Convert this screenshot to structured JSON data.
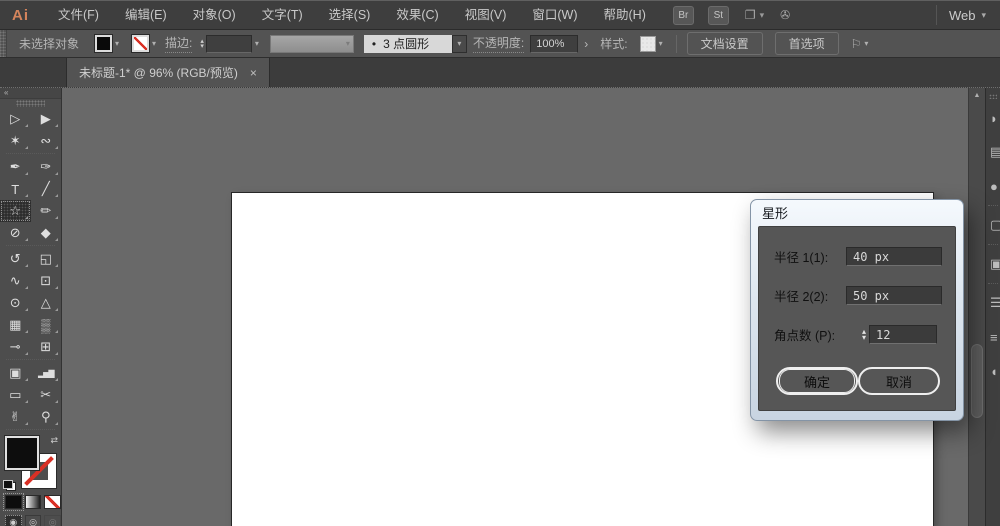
{
  "app": {
    "logo": "Ai",
    "workspace": "Web"
  },
  "icons": {
    "chevron": "▾",
    "collapse": "«",
    "swap": "⇄",
    "spin_up": "▴",
    "spin_down": "▾",
    "expand": "›",
    "close": "×",
    "scroll_up": "▲",
    "dot": "•",
    "br": "Br",
    "st": "St",
    "layout": "❐",
    "touch": "✇",
    "flag": "⚐"
  },
  "menubar": {
    "items": [
      "文件(F)",
      "编辑(E)",
      "对象(O)",
      "文字(T)",
      "选择(S)",
      "效果(C)",
      "视图(V)",
      "窗口(W)",
      "帮助(H)"
    ]
  },
  "controlbar": {
    "no_selection": "未选择对象",
    "stroke_label": "描边:",
    "brush_name": "3 点圆形",
    "opacity_label": "不透明度:",
    "opacity_value": "100%",
    "style_label": "样式:",
    "doc_setup": "文档设置",
    "preferences": "首选项"
  },
  "tabbar": {
    "title": "未标题-1* @ 96% (RGB/预览)"
  },
  "toolbar": {
    "tools": [
      {
        "name": "selection-tool",
        "glyph": "▷"
      },
      {
        "name": "direct-selection-tool",
        "glyph": "▶"
      },
      {
        "name": "magic-wand-tool",
        "glyph": "✶"
      },
      {
        "name": "lasso-tool",
        "glyph": "∾"
      },
      {
        "name": "pen-tool",
        "glyph": "✒"
      },
      {
        "name": "curvature-tool",
        "glyph": "✑"
      },
      {
        "name": "type-tool",
        "glyph": "T"
      },
      {
        "name": "line-tool",
        "glyph": "╱"
      },
      {
        "name": "star-tool",
        "glyph": "☆"
      },
      {
        "name": "paintbrush-tool",
        "glyph": "✏"
      },
      {
        "name": "shaper-tool",
        "glyph": "⊘"
      },
      {
        "name": "eraser-tool",
        "glyph": "◆"
      },
      {
        "name": "rotate-tool",
        "glyph": "↺"
      },
      {
        "name": "scale-tool",
        "glyph": "◱"
      },
      {
        "name": "width-tool",
        "glyph": "∿"
      },
      {
        "name": "free-transform-tool",
        "glyph": "⊡"
      },
      {
        "name": "shape-builder-tool",
        "glyph": "⊙"
      },
      {
        "name": "perspective-grid-tool",
        "glyph": "△"
      },
      {
        "name": "mesh-tool",
        "glyph": "▦"
      },
      {
        "name": "gradient-tool",
        "glyph": "▒"
      },
      {
        "name": "eyedropper-tool",
        "glyph": "⊸"
      },
      {
        "name": "blend-tool",
        "glyph": "⊞"
      },
      {
        "name": "symbol-sprayer-tool",
        "glyph": "▣"
      },
      {
        "name": "column-graph-tool",
        "glyph": "▂▅▇"
      },
      {
        "name": "artboard-tool",
        "glyph": "▭"
      },
      {
        "name": "slice-tool",
        "glyph": "✂"
      },
      {
        "name": "hand-tool",
        "glyph": "✌"
      },
      {
        "name": "zoom-tool",
        "glyph": "⚲"
      }
    ],
    "modes": [
      {
        "name": "draw-normal",
        "glyph": "◉"
      },
      {
        "name": "draw-behind",
        "glyph": "◎"
      },
      {
        "name": "draw-inside",
        "glyph": "◎"
      }
    ]
  },
  "dock": {
    "items": [
      {
        "glyph": "◗"
      },
      {
        "glyph": "▤"
      },
      {
        "glyph": "●"
      },
      {
        "glyph": "▢"
      },
      {
        "glyph": "▣"
      },
      {
        "glyph": "☰"
      },
      {
        "glyph": "≡"
      },
      {
        "glyph": "◖"
      }
    ]
  },
  "dialog": {
    "title": "星形",
    "fields": [
      {
        "label": "半径 1(1):",
        "value": "40 px"
      },
      {
        "label": "半径 2(2):",
        "value": "50 px"
      },
      {
        "label": "角点数 (P):",
        "value": "12"
      }
    ],
    "ok_label": "确定",
    "cancel_label": "取消"
  },
  "colors": {
    "accent_orange": "#d4845c",
    "titlebar_gray": "#3e3e3e",
    "dialog_body": "#565656",
    "slash_red": "#d93025"
  }
}
